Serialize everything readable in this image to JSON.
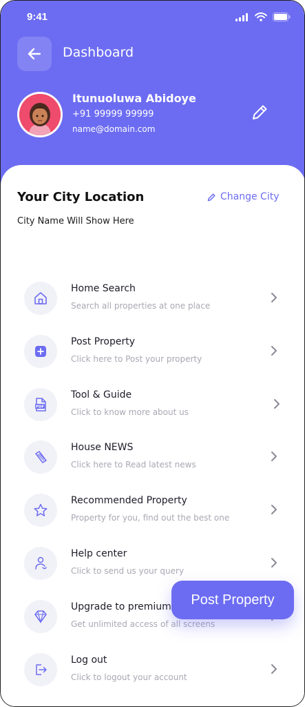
{
  "status_bar": {
    "time": "9:41"
  },
  "header": {
    "title": "Dashboard"
  },
  "profile": {
    "name": "Itunuoluwa Abidoye",
    "phone": "+91 99999 99999",
    "email": "name@domain.com"
  },
  "city": {
    "heading": "Your City Location",
    "change_label": "Change City",
    "name": "City Name Will Show Here"
  },
  "menu": [
    {
      "label": "Home Search",
      "sub": "Search all properties at one place",
      "icon": "home-icon"
    },
    {
      "label": "Post Property",
      "sub": "Click here to Post your property",
      "icon": "plus-square-icon"
    },
    {
      "label": "Tool & Guide",
      "sub": "Click to know more about us",
      "icon": "pdf-file-icon"
    },
    {
      "label": "House NEWS",
      "sub": "Click here to Read latest news",
      "icon": "news-icon"
    },
    {
      "label": "Recommended Property",
      "sub": "Property for you, find out the best one",
      "icon": "star-icon"
    },
    {
      "label": "Help center",
      "sub": "Click to send us your query",
      "icon": "support-icon"
    },
    {
      "label": "Upgrade to premium",
      "sub": "Get unlimited access of all screens",
      "icon": "diamond-icon"
    },
    {
      "label": "Log out",
      "sub": "Click to logout your account",
      "icon": "logout-icon"
    }
  ],
  "fab": {
    "label": "Post Property"
  },
  "colors": {
    "accent": "#6c6cf2",
    "icon_bg": "#f1f1f8",
    "subtext": "#a8a8b3"
  }
}
